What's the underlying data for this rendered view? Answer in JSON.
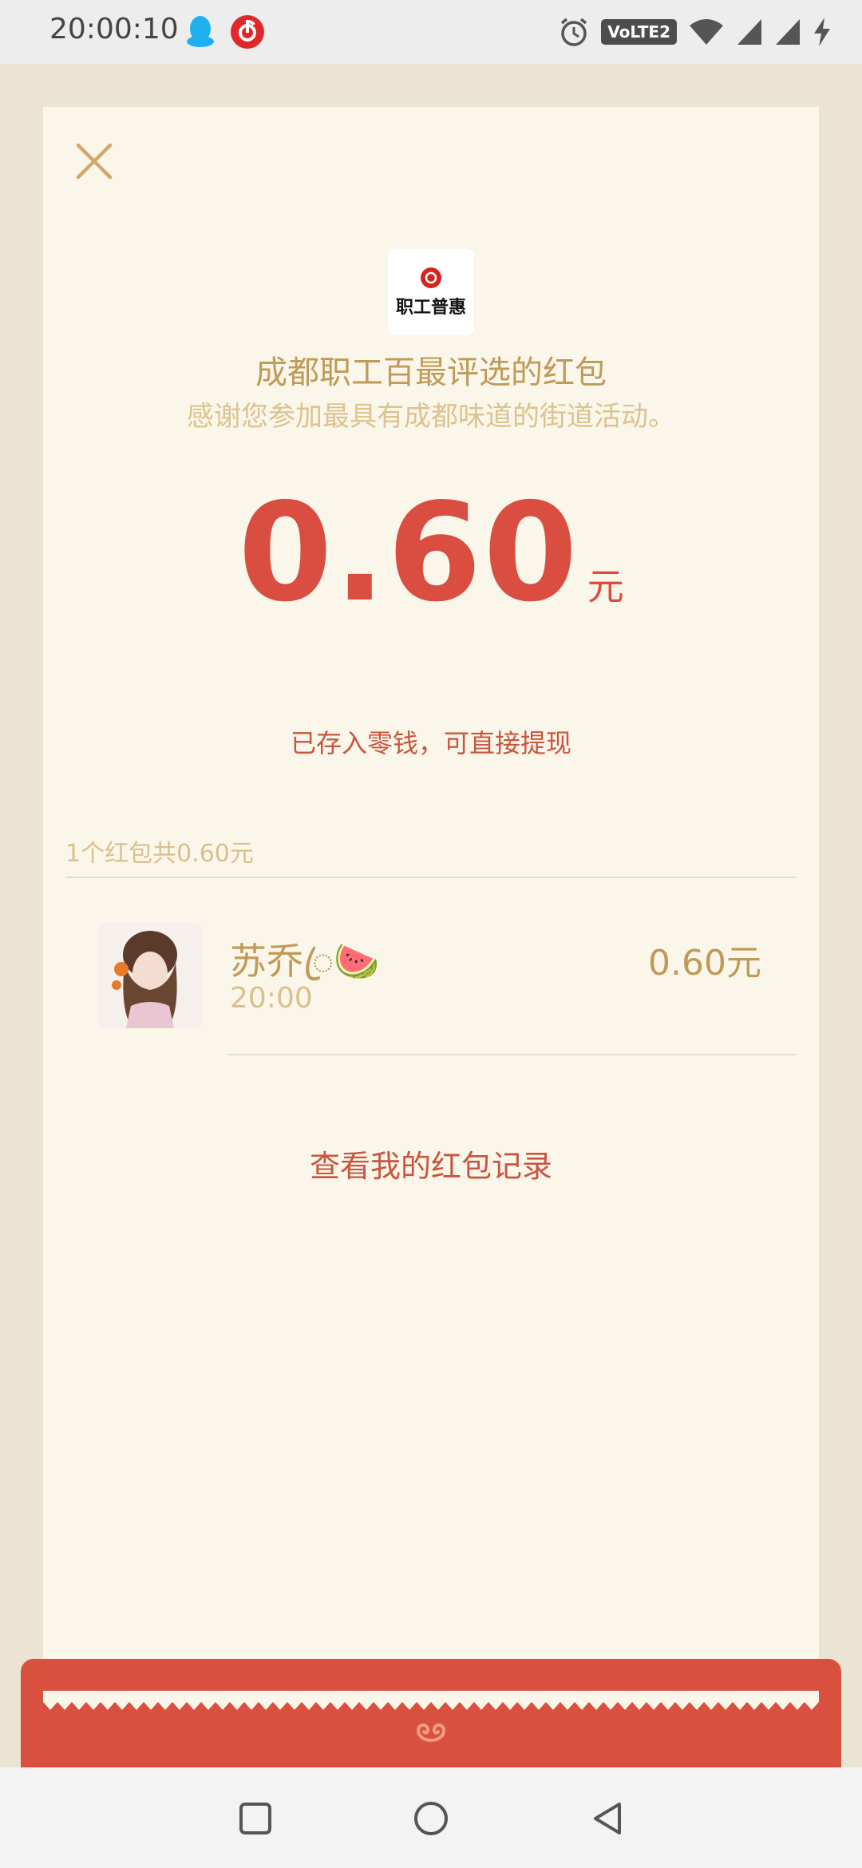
{
  "status_bar": {
    "time": "20:00:10",
    "left_icons": [
      "qq-icon",
      "netease-music-icon"
    ],
    "right_icons": [
      "alarm-icon",
      "volte-icon",
      "wifi-icon",
      "signal-icon",
      "signal-icon",
      "charging-icon"
    ],
    "volte_label": "VoLTE2"
  },
  "card": {
    "logo_text": "职工普惠",
    "title": "成都职工百最评选的红包",
    "subtitle": "感谢您参加最具有成都味道的街道活动。",
    "amount": "0.60",
    "amount_unit": "元",
    "saved_note": "已存入零钱，可直接提现",
    "summary": "1个红包共0.60元",
    "records": [
      {
        "name": "苏乔ꦿ🍉",
        "time": "20:00",
        "amount": "0.60元"
      }
    ],
    "history_link": "查看我的红包记录"
  },
  "colors": {
    "card_bg": "#faf6ea",
    "page_bg": "#ece4d2",
    "gold": "#c09a58",
    "red": "#d94e40"
  },
  "nav": [
    "recents-button",
    "home-button",
    "back-button"
  ]
}
